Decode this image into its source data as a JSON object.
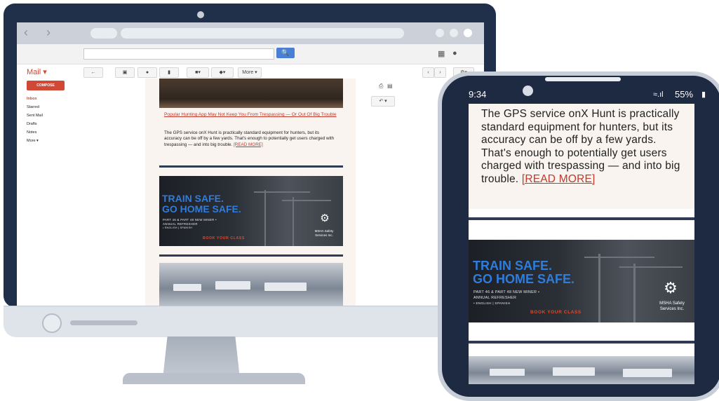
{
  "desktop": {
    "gmail": {
      "search_button_icon": "search-icon",
      "mail_label": "Mail ▾",
      "compose_label": "COMPOSE",
      "more_label": "More ▾",
      "sidebar_items": [
        "Inbox",
        "Starred",
        "Sent Mail",
        "Drafts",
        "Notes",
        "More ▾"
      ]
    },
    "email": {
      "article_title": "Popular Hunting App May Not Keep You From Trespassing — Or Out Of Big Trouble",
      "article_body": "The GPS service onX Hunt is practically standard equipment for hunters, but its accuracy can be off by a few yards. That's enough to potentially get users charged with trespassing — and into big trouble.",
      "read_more": "[READ MORE]"
    }
  },
  "ad": {
    "headline_line1": "TRAIN SAFE.",
    "headline_line2": "GO HOME SAFE.",
    "subline1": "PART 46 & PART 48 NEW MINER •",
    "subline2": "ANNUAL REFRESHER",
    "subline3": "• ENGLISH | SPANISH",
    "cta": "BOOK YOUR CLASS",
    "logo_line1": "MSHA Safety",
    "logo_line2": "Services Inc."
  },
  "phone": {
    "time": "9:34",
    "battery": "55%",
    "article_body": "The GPS service onX Hunt is practically standard equipment for hunters, but its accuracy can be off by a few yards. That's enough to potentially get users charged with trespassing — and into big trouble.",
    "read_more": "[READ MORE]"
  },
  "colors": {
    "frame": "#20304a",
    "accent_red": "#c0392b",
    "gmail_red": "#d14836",
    "ad_blue": "#2f7ddb",
    "divider": "#2e3b52"
  }
}
